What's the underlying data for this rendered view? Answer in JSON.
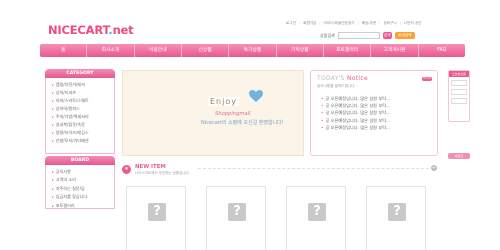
{
  "logo": {
    "main": "NICECART",
    "dot": ".",
    "tld": "net"
  },
  "toplinks": [
    "로그인",
    "회원가입",
    "아이디/비밀번호찾기",
    "배송/주문",
    "장바구니",
    "나만의 공간"
  ],
  "search": {
    "label": "상품검색",
    "go": "검색",
    "detail": "상세검색"
  },
  "nav": [
    "홈",
    "회사소개",
    "이용안내",
    "신상품",
    "특가상품",
    "기획상품",
    "포토갤러리",
    "고객게시판",
    "FAQ"
  ],
  "sidebar": {
    "category_title": "CATEGORY",
    "categories": [
      "캠핑/자전거/레저",
      "상의/티셔츠",
      "하의/스커트/스웨트",
      "상하의/원피스",
      "주의/가방/액세서리",
      "실내복/잠옷/속옷",
      "양말/타이즈/레깅스",
      "신발/모자/기타패션"
    ],
    "board_title": "BOARD",
    "board": [
      "공지사항",
      "고객의 소리",
      "자주하는 질문/답",
      "입금자를 찾습니다.",
      "포토갤러리"
    ]
  },
  "banner": {
    "enjoy": "Enjoy",
    "shopping": "Shoppingmall",
    "tagline": "Nicecart의 쇼핑에 오신걸 환영합니다!"
  },
  "notice": {
    "title_prefix": "TODAY'S ",
    "title_main": "Notice",
    "subtitle": "공지사항을 알려드립니다.",
    "more": "more",
    "items": [
      "공 오픈예정입니다. 많은 성원 부탁...",
      "공 오픈예정입니다. 많은 성원 부탁...",
      "공 오픈예정입니다. 많은 성원 부탁...",
      "공 오픈예정입니다. 많은 성원 부탁...",
      "공 오픈예정입니다. 많은 성원 부탁..."
    ]
  },
  "quick": {
    "head": "오늘본상품",
    "foot": "맨위로"
  },
  "newitem": {
    "icon": "★",
    "title": "NEW ITEM",
    "subtitle": "나이스카트에서 추천하는 상품입니다.",
    "more": "+"
  },
  "products": [
    {
      "img": "?"
    },
    {
      "img": "?"
    },
    {
      "img": "?"
    },
    {
      "img": "?"
    }
  ]
}
